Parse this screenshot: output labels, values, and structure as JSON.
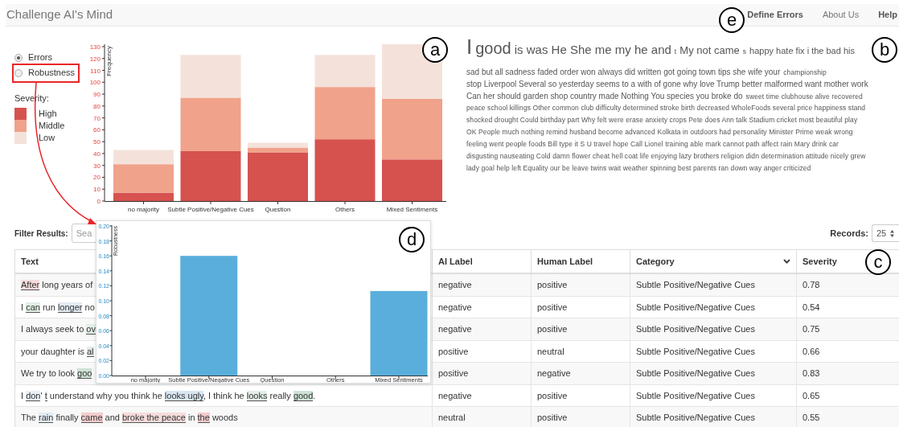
{
  "app": {
    "title": "Challenge AI's Mind",
    "nav": [
      {
        "label": "Define Errors",
        "emphasized": true
      },
      {
        "label": "About Us",
        "emphasized": false
      },
      {
        "label": "Help",
        "emphasized": true
      }
    ]
  },
  "view_options": [
    {
      "label": "Errors",
      "selected": true
    },
    {
      "label": "Robustness",
      "selected": false
    }
  ],
  "legend": {
    "title": "Severity:"
  },
  "errors_chart": {
    "chart_data": {
      "type": "bar",
      "stacked": true,
      "ylabel": "Frequency",
      "categories": [
        "no majority",
        "Subtle Positive/Negative Cues",
        "Question",
        "Others",
        "Mixed Sentiments"
      ],
      "ylim": [
        0,
        132
      ],
      "yticks": [
        0,
        10,
        20,
        30,
        40,
        50,
        60,
        70,
        80,
        90,
        100,
        110,
        120,
        130
      ],
      "series": [
        {
          "name": "High",
          "color": "#d6524f",
          "values": [
            7,
            42,
            41,
            52,
            35
          ]
        },
        {
          "name": "Middle",
          "color": "#f0a28a",
          "values": [
            24,
            45,
            4,
            44,
            51
          ]
        },
        {
          "name": "Low",
          "color": "#f4e2da",
          "values": [
            12,
            36,
            4,
            27,
            46
          ]
        }
      ]
    }
  },
  "word_cloud": [
    {
      "runs": [
        {
          "kind": "huge",
          "text": "I"
        },
        {
          "kind": "xlarge",
          "text": "good"
        },
        {
          "kind": "large",
          "text": "is was He She me my he and"
        },
        {
          "kind": "small",
          "text": "t"
        },
        {
          "kind": "medium",
          "text": "My not came"
        },
        {
          "kind": "small",
          "text": "s"
        },
        {
          "kind": "mediumsmall",
          "text": "happy hate fix i the bad his"
        }
      ]
    },
    {
      "runs": [
        {
          "kind": "normal",
          "text": "sad but all sadness faded order won always did written got going town tips she wife your"
        },
        {
          "kind": "small",
          "text": "championship"
        }
      ]
    },
    {
      "runs": [
        {
          "kind": "normal",
          "text": "stop Liverpool Several so yesterday seems to a with of gone why love Trump better malformed want mother work"
        }
      ]
    },
    {
      "runs": [
        {
          "kind": "normal",
          "text": "Can her should garden shop country made Nothing You species you broke do"
        },
        {
          "kind": "small",
          "text": "sweet time clubhouse alive recovered"
        }
      ]
    },
    {
      "runs": [
        {
          "kind": "small",
          "text": "peace school killings Other common club difficulty determined stroke birth decreased WholeFoods several price happiness stand"
        }
      ]
    },
    {
      "runs": [
        {
          "kind": "small",
          "text": "shocked drought Could birthday part Why felt were erase anxiety crops Pete does Ann talk Stadium cricket most beautiful play"
        }
      ]
    },
    {
      "runs": [
        {
          "kind": "small",
          "text": "OK People much nothing remind husband become advanced Kolkata in outdoors had personality Minister Prime weak wrong"
        }
      ]
    },
    {
      "runs": [
        {
          "kind": "small",
          "text": "feeling went people foods Bill type it S U travel hope Call Lionel training able mark cannot path affect rain Mary drink car"
        }
      ]
    },
    {
      "runs": [
        {
          "kind": "small",
          "text": "disgusting nauseating Cold damn flower cheat hell coat life enjoying lazy brothers religion didn determination attitude nicely grew"
        }
      ]
    },
    {
      "runs": [
        {
          "kind": "small",
          "text": "lady goal help left Equality our be leave twins wait weather spinning best parents ran down way anger criticized"
        }
      ]
    }
  ],
  "filter": {
    "label": "Filter Results:",
    "placeholder": "Sea"
  },
  "records": {
    "label": "Records:",
    "value": "25"
  },
  "table": {
    "columns": [
      {
        "label": "Text",
        "sortable": false
      },
      {
        "label": "AI Label",
        "sortable": false
      },
      {
        "label": "Human Label",
        "sortable": false
      },
      {
        "label": "Category",
        "sortable": true
      },
      {
        "label": "Severity",
        "sortable": false
      }
    ],
    "rows": [
      {
        "text": [
          {
            "text": "After",
            "color": "#f6dcdc"
          },
          {
            "text": " long years of"
          }
        ],
        "ai_label": "negative",
        "human_label": "positive",
        "category": "Subtle Positive/Negative Cues",
        "severity": "0.78"
      },
      {
        "text": [
          {
            "text": "I "
          },
          {
            "text": "can",
            "color": "#e2eee6"
          },
          {
            "text": " run "
          },
          {
            "text": "longer",
            "color": "#e3ebf3"
          },
          {
            "text": " no"
          }
        ],
        "ai_label": "negative",
        "human_label": "positive",
        "category": "Subtle Positive/Negative Cues",
        "severity": "0.54"
      },
      {
        "text": [
          {
            "text": "I always seek to "
          },
          {
            "text": "ov",
            "color": "#e2eee6"
          }
        ],
        "ai_label": "negative",
        "human_label": "positive",
        "category": "Subtle Positive/Negative Cues",
        "severity": "0.75"
      },
      {
        "text": [
          {
            "text": "your daughter is "
          },
          {
            "text": "al",
            "color": "#e2eee6"
          }
        ],
        "ai_label": "positive",
        "human_label": "neutral",
        "category": "Subtle Positive/Negative Cues",
        "severity": "0.66"
      },
      {
        "text": [
          {
            "text": "We try to look "
          },
          {
            "text": "goo",
            "color": "#cfe2d6"
          }
        ],
        "ai_label": "positive",
        "human_label": "negative",
        "category": "Subtle Positive/Negative Cues",
        "severity": "0.83"
      },
      {
        "text": [
          {
            "text": "I "
          },
          {
            "text": "don",
            "color": "#e8f0f6"
          },
          {
            "text": "' "
          },
          {
            "text": "t",
            "color": "#e8f0f6"
          },
          {
            "text": " understand why you think he "
          },
          {
            "text": "looks ugly",
            "color": "#d8e6f2"
          },
          {
            "text": ", I think he "
          },
          {
            "text": "looks",
            "color": "#e2eee6"
          },
          {
            "text": " really "
          },
          {
            "text": "good",
            "color": "#cfe2d6"
          },
          {
            "text": "."
          }
        ],
        "ai_label": "negative",
        "human_label": "positive",
        "category": "Subtle Positive/Negative Cues",
        "severity": "0.65"
      },
      {
        "text": [
          {
            "text": "The "
          },
          {
            "text": "rain",
            "color": "#e3ebf3"
          },
          {
            "text": " finally "
          },
          {
            "text": "came",
            "color": "#f4cccc"
          },
          {
            "text": " and "
          },
          {
            "text": "broke the peace",
            "color": "#f6dcdc"
          },
          {
            "text": " in "
          },
          {
            "text": "the",
            "color": "#f4cccc"
          },
          {
            "text": " woods"
          }
        ],
        "ai_label": "neutral",
        "human_label": "positive",
        "category": "Subtle Positive/Negative Cues",
        "severity": "0.55"
      }
    ]
  },
  "robustness_chart": {
    "chart_data": {
      "type": "bar",
      "ylabel": "Robustness",
      "categories": [
        "no majority",
        "Subtle Positive/Negative Cues",
        "Question",
        "Others",
        "Mixed Sentiments"
      ],
      "values": [
        0,
        0.16,
        0,
        0,
        0.113
      ],
      "ylim": [
        0,
        0.2
      ],
      "yticks": [
        {
          "value": 0,
          "label": "0.00"
        },
        {
          "value": 0.02,
          "label": "0.02"
        },
        {
          "value": 0.04,
          "label": "0.04"
        },
        {
          "value": 0.06,
          "label": "0.06"
        },
        {
          "value": 0.08,
          "label": "0.08"
        },
        {
          "value": 0.1,
          "label": "0.10"
        },
        {
          "value": 0.12,
          "label": "0.12"
        },
        {
          "value": 0.14,
          "label": "0.14"
        },
        {
          "value": 0.16,
          "label": "0.16"
        },
        {
          "value": 0.18,
          "label": "0.18"
        },
        {
          "value": 0.2,
          "label": "0.20"
        }
      ]
    }
  },
  "annotations": [
    {
      "label": "a"
    },
    {
      "label": "b"
    },
    {
      "label": "c"
    },
    {
      "label": "d"
    },
    {
      "label": "e"
    }
  ]
}
